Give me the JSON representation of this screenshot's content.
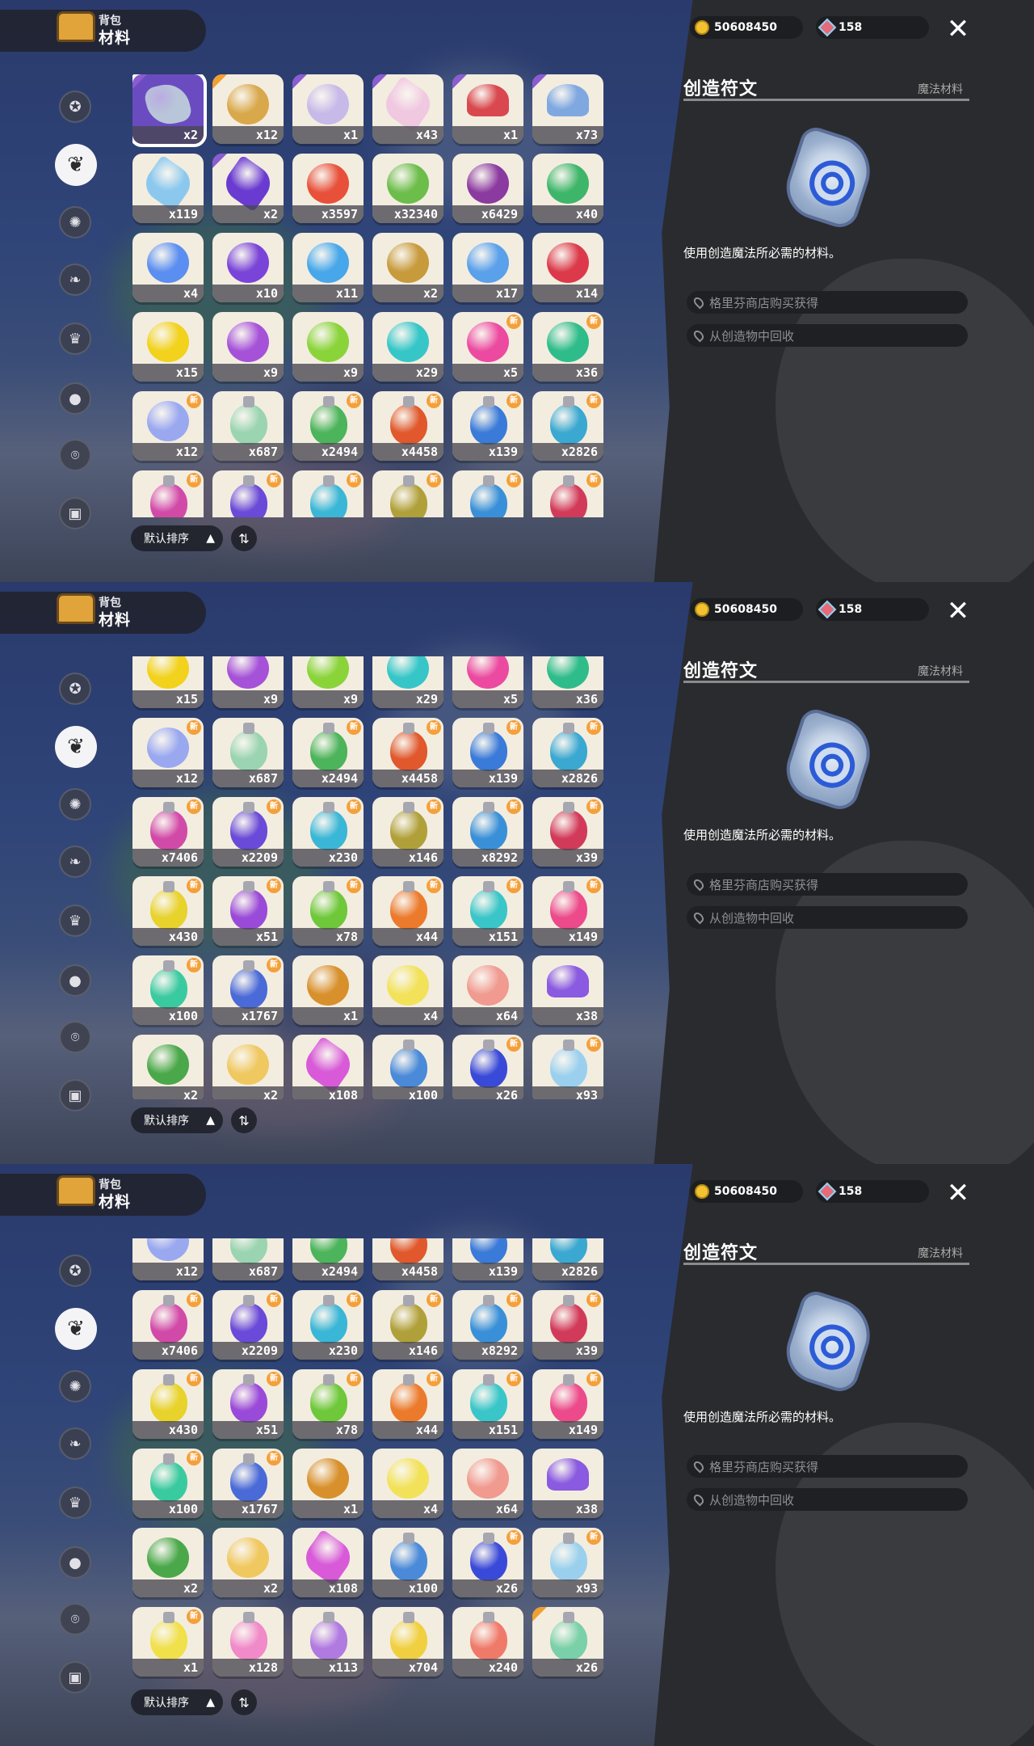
{
  "header": {
    "sub": "背包",
    "main": "材料"
  },
  "currency": {
    "coins": "50608450",
    "gems": "158"
  },
  "detail": {
    "title": "创造符文",
    "category": "魔法材料",
    "description": "使用创造魔法所必需的材料。",
    "sources": [
      "格里芬商店购买获得",
      "从创造物中回收"
    ]
  },
  "sort": {
    "label": "默认排序"
  },
  "categories": [
    "star-tab-icon",
    "leaf-tab-icon",
    "burst-tab-icon",
    "plant-tab-icon",
    "crown-tab-icon",
    "ball-tab-icon",
    "acorn-tab-icon",
    "chest-tab-icon"
  ],
  "items": [
    {
      "q": "x2",
      "c": "#b9c6d9",
      "s": "rock",
      "r": "#8a5cd0"
    },
    {
      "q": "x12",
      "c": "#d9a84b",
      "s": "round",
      "r": "#f0a030"
    },
    {
      "q": "x1",
      "c": "#c7b9e8",
      "s": "round",
      "r": "#8a5cd0"
    },
    {
      "q": "x43",
      "c": "#f0c8e0",
      "s": "gem",
      "r": "#8a5cd0"
    },
    {
      "q": "x1",
      "c": "#d9484e",
      "s": "shroom",
      "r": "#8a5cd0"
    },
    {
      "q": "x73",
      "c": "#7fa8e0",
      "s": "shroom",
      "r": "#8a5cd0"
    },
    {
      "q": "x119",
      "c": "#8cc8ee",
      "s": "gem",
      "r": ""
    },
    {
      "q": "x2",
      "c": "#6a3bd0",
      "s": "gem",
      "r": "#8a5cd0"
    },
    {
      "q": "x3597",
      "c": "#e8503a",
      "s": "round",
      "r": ""
    },
    {
      "q": "x32340",
      "c": "#6cbd4a",
      "s": "round",
      "r": ""
    },
    {
      "q": "x6429",
      "c": "#8b3aa0",
      "s": "round",
      "r": ""
    },
    {
      "q": "x40",
      "c": "#3eb66a",
      "s": "round",
      "r": ""
    },
    {
      "q": "x4",
      "c": "#5a8ef0",
      "s": "round",
      "r": ""
    },
    {
      "q": "x10",
      "c": "#7a44d8",
      "s": "round",
      "r": ""
    },
    {
      "q": "x11",
      "c": "#47a7ea",
      "s": "round",
      "r": ""
    },
    {
      "q": "x2",
      "c": "#c79a3c",
      "s": "round",
      "r": ""
    },
    {
      "q": "x17",
      "c": "#5aa0ea",
      "s": "round",
      "r": ""
    },
    {
      "q": "x14",
      "c": "#dc3a4a",
      "s": "round",
      "r": ""
    },
    {
      "q": "x15",
      "c": "#f2d21c",
      "s": "round",
      "r": ""
    },
    {
      "q": "x9",
      "c": "#a552d8",
      "s": "round",
      "r": ""
    },
    {
      "q": "x9",
      "c": "#8ad43a",
      "s": "round",
      "r": ""
    },
    {
      "q": "x29",
      "c": "#36c6c8",
      "s": "round",
      "r": ""
    },
    {
      "q": "x5",
      "c": "#ec4aa0",
      "s": "round",
      "r": "",
      "n": 1
    },
    {
      "q": "x36",
      "c": "#2ebc8a",
      "s": "round",
      "r": "",
      "n": 1
    },
    {
      "q": "x12",
      "c": "#9aa8f0",
      "s": "round",
      "r": "",
      "n": 1
    },
    {
      "q": "x687",
      "c": "#9ad4b0",
      "s": "potion",
      "r": ""
    },
    {
      "q": "x2494",
      "c": "#4cb45a",
      "s": "potion",
      "r": "",
      "n": 1
    },
    {
      "q": "x4458",
      "c": "#e0582c",
      "s": "potion",
      "r": "",
      "n": 1
    },
    {
      "q": "x139",
      "c": "#3a7ad8",
      "s": "potion",
      "r": "",
      "n": 1
    },
    {
      "q": "x2826",
      "c": "#3aa8d0",
      "s": "potion",
      "r": "",
      "n": 1
    },
    {
      "q": "x7406",
      "c": "#d24aa8",
      "s": "potion",
      "r": "",
      "n": 1
    },
    {
      "q": "x2209",
      "c": "#6a4ad8",
      "s": "potion",
      "r": "",
      "n": 1
    },
    {
      "q": "x230",
      "c": "#3ab6d6",
      "s": "potion",
      "r": "",
      "n": 1
    },
    {
      "q": "x146",
      "c": "#b0a03a",
      "s": "potion",
      "r": "",
      "n": 1
    },
    {
      "q": "x8292",
      "c": "#3a90d8",
      "s": "potion",
      "r": "",
      "n": 1
    },
    {
      "q": "x39",
      "c": "#d23a5a",
      "s": "potion",
      "r": "",
      "n": 1
    },
    {
      "q": "x430",
      "c": "#e8d22c",
      "s": "potion",
      "r": "",
      "n": 1
    },
    {
      "q": "x51",
      "c": "#9a4ad8",
      "s": "potion",
      "r": "",
      "n": 1
    },
    {
      "q": "x78",
      "c": "#6ec83a",
      "s": "potion",
      "r": "",
      "n": 1
    },
    {
      "q": "x44",
      "c": "#ec7a2c",
      "s": "potion",
      "r": "",
      "n": 1
    },
    {
      "q": "x151",
      "c": "#3ac6c8",
      "s": "potion",
      "r": "",
      "n": 1
    },
    {
      "q": "x149",
      "c": "#ec4a8a",
      "s": "potion",
      "r": "",
      "n": 1
    },
    {
      "q": "x100",
      "c": "#3acaa0",
      "s": "potion",
      "r": "",
      "n": 1
    },
    {
      "q": "x1767",
      "c": "#4a6ad8",
      "s": "potion",
      "r": "",
      "n": 1
    },
    {
      "q": "x1",
      "c": "#d8902c",
      "s": "round",
      "r": ""
    },
    {
      "q": "x4",
      "c": "#f2e25a",
      "s": "round",
      "r": ""
    },
    {
      "q": "x64",
      "c": "#f09a90",
      "s": "round",
      "r": ""
    },
    {
      "q": "x38",
      "c": "#8a5ae0",
      "s": "shroom",
      "r": ""
    },
    {
      "q": "x2",
      "c": "#4aa84a",
      "s": "round",
      "r": ""
    },
    {
      "q": "x2",
      "c": "#f0c860",
      "s": "round",
      "r": ""
    },
    {
      "q": "x108",
      "c": "#d85ad8",
      "s": "gem",
      "r": ""
    },
    {
      "q": "x100",
      "c": "#4a8ad8",
      "s": "potion",
      "r": ""
    },
    {
      "q": "x26",
      "c": "#3a4ad8",
      "s": "potion",
      "r": "",
      "n": 1
    },
    {
      "q": "x93",
      "c": "#9ad0ee",
      "s": "potion",
      "r": "",
      "n": 1
    },
    {
      "q": "x1",
      "c": "#f0e04a",
      "s": "potion",
      "r": "",
      "n": 1
    },
    {
      "q": "x128",
      "c": "#f08ac8",
      "s": "potion",
      "r": ""
    },
    {
      "q": "x113",
      "c": "#b07ae0",
      "s": "potion",
      "r": ""
    },
    {
      "q": "x704",
      "c": "#f0d040",
      "s": "potion",
      "r": ""
    },
    {
      "q": "x240",
      "c": "#f07a6a",
      "s": "potion",
      "r": ""
    },
    {
      "q": "x26",
      "c": "#7ad0a8",
      "s": "potion",
      "r": "#f0a030"
    }
  ],
  "views": [
    {
      "start": 0
    },
    {
      "start": 18
    },
    {
      "start": 24
    }
  ]
}
